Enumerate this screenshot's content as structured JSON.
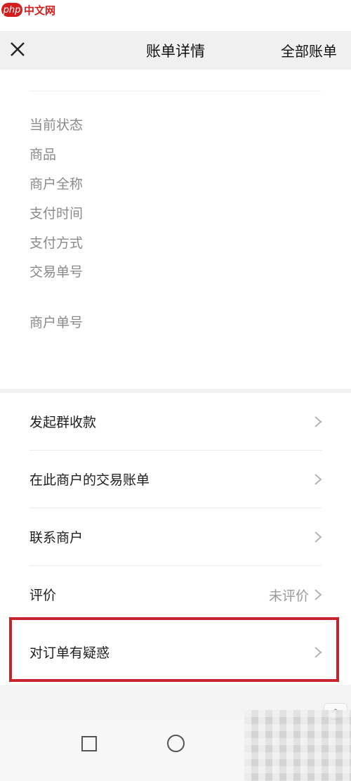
{
  "watermark": {
    "badge": "php",
    "text": "中文网"
  },
  "header": {
    "title": "账单详情",
    "right_link": "全部账单",
    "close_icon": "close-icon"
  },
  "details": {
    "labels": [
      "当前状态",
      "商品",
      "商户全称",
      "支付时间",
      "支付方式",
      "交易单号",
      "商户单号"
    ]
  },
  "menu": {
    "items": [
      {
        "label": "发起群收款",
        "value": ""
      },
      {
        "label": "在此商户的交易账单",
        "value": ""
      },
      {
        "label": "联系商户",
        "value": ""
      },
      {
        "label": "评价",
        "value": "未评价"
      },
      {
        "label": "对订单有疑惑",
        "value": ""
      }
    ]
  },
  "colors": {
    "highlight": "#c8242c",
    "header_bg": "#f0f0f0"
  },
  "navbar": {
    "icons": [
      "recent-apps-icon",
      "home-icon"
    ]
  }
}
